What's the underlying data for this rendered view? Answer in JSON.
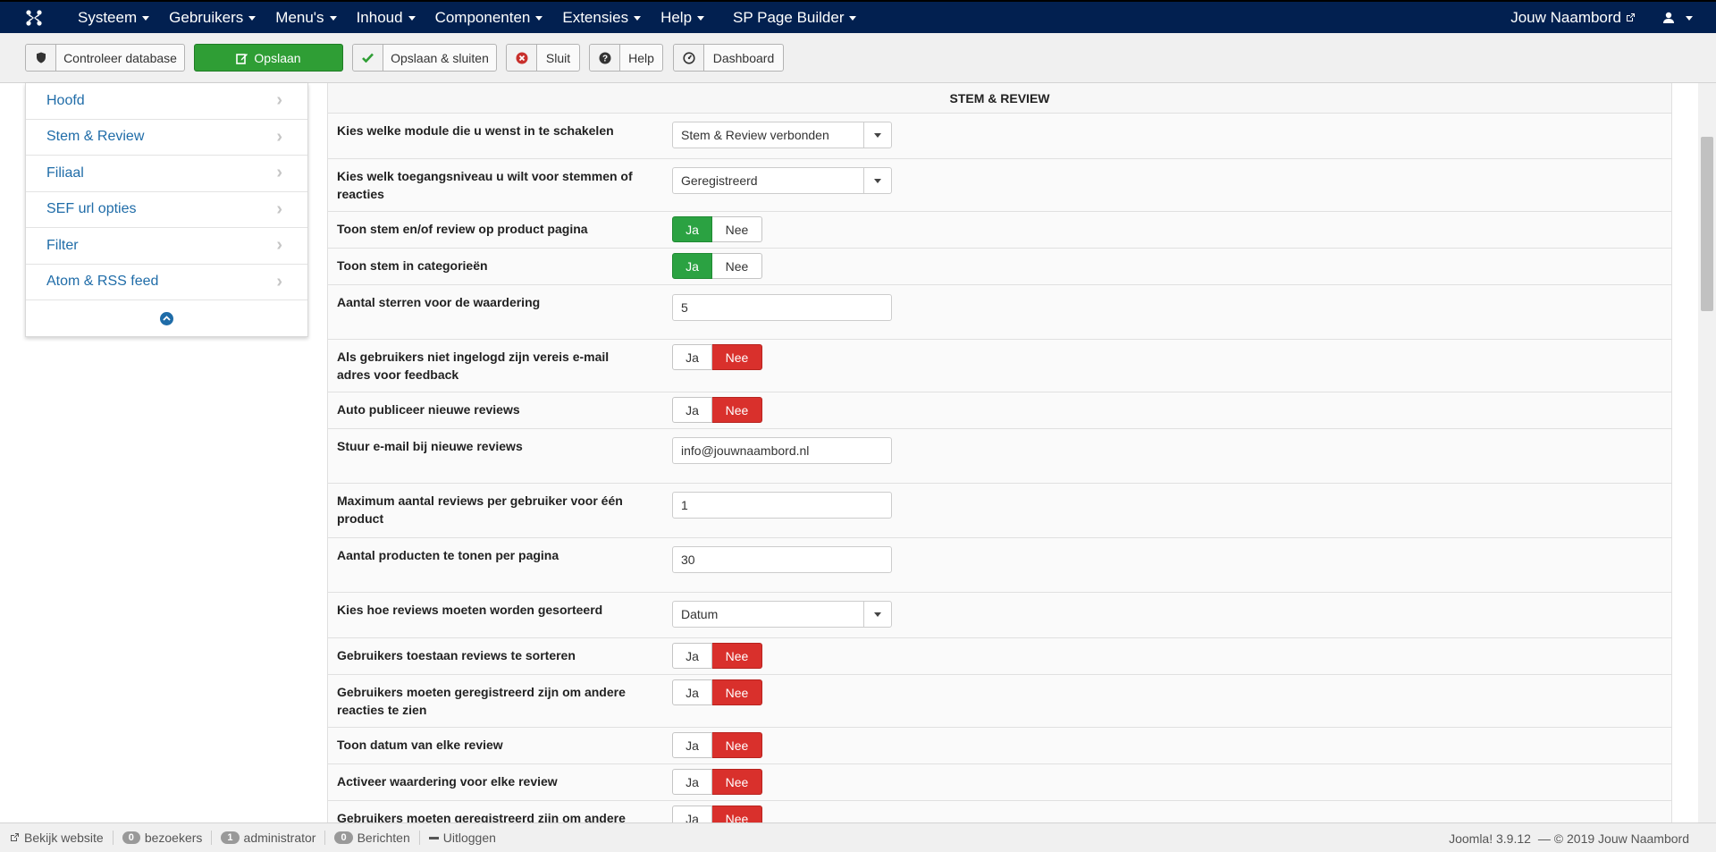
{
  "navbar": {
    "menu": [
      "Systeem",
      "Gebruikers",
      "Menu's",
      "Inhoud",
      "Componenten",
      "Extensies",
      "Help",
      "SP Page Builder"
    ],
    "site_name": "Jouw Naambord"
  },
  "toolbar": {
    "check_db": "Controleer database",
    "save": "Opslaan",
    "save_close": "Opslaan & sluiten",
    "close": "Sluit",
    "help": "Help",
    "dashboard": "Dashboard"
  },
  "sidebar": {
    "items": [
      "Hoofd",
      "Stem & Review",
      "Filiaal",
      "SEF url opties",
      "Filter",
      "Atom & RSS feed"
    ]
  },
  "section": {
    "title": "STEM & REVIEW"
  },
  "toggle_labels": {
    "yes": "Ja",
    "no": "Nee"
  },
  "fields": {
    "module": {
      "label": "Kies welke module die u wenst in te schakelen",
      "value": "Stem & Review verbonden"
    },
    "access": {
      "label": "Kies welk toegangsniveau u wilt voor stemmen of reacties",
      "value": "Geregistreerd"
    },
    "show_on_product": {
      "label": "Toon stem en/of review op product pagina",
      "value": "Ja"
    },
    "show_in_categories": {
      "label": "Toon stem in categorieën",
      "value": "Ja"
    },
    "stars": {
      "label": "Aantal sterren voor de waardering",
      "value": "5"
    },
    "email_required": {
      "label": "Als gebruikers niet ingelogd zijn vereis e-mail adres voor feedback",
      "value": "Nee"
    },
    "auto_publish": {
      "label": "Auto publiceer nieuwe reviews",
      "value": "Nee"
    },
    "notify_email": {
      "label": "Stuur e-mail bij nieuwe reviews",
      "value": "info@jouwnaambord.nl"
    },
    "max_reviews": {
      "label": "Maximum aantal reviews per gebruiker voor één product",
      "value": "1"
    },
    "products_per_page": {
      "label": "Aantal producten te tonen per pagina",
      "value": "30"
    },
    "sort_by": {
      "label": "Kies hoe reviews moeten worden gesorteerd",
      "value": "Datum"
    },
    "allow_sort": {
      "label": "Gebruikers toestaan reviews te sorteren",
      "value": "Nee"
    },
    "registered_view": {
      "label": "Gebruikers moeten geregistreerd zijn om andere reacties te zien",
      "value": "Nee"
    },
    "show_date": {
      "label": "Toon datum van elke review",
      "value": "Nee"
    },
    "rating_each": {
      "label": "Activeer waardering voor elke review",
      "value": "Nee"
    },
    "registered_more": {
      "label": "Gebruikers moeten geregistreerd zijn om andere",
      "value": "Nee"
    }
  },
  "statusbar": {
    "view_site": "Bekijk website",
    "visitors_count": "0",
    "visitors_label": "bezoekers",
    "admin_count": "1",
    "admin_label": "administrator",
    "messages_count": "0",
    "messages_label": "Berichten",
    "logout": "Uitloggen",
    "version": "Joomla! 3.9.12",
    "copyright": "— © 2019 Jouw Naambord"
  },
  "colors": {
    "navbar": "#022050",
    "save_green": "#2f9e35",
    "toggle_yes": "#2ba242",
    "toggle_no": "#d9302c",
    "link": "#1f6ca8"
  }
}
